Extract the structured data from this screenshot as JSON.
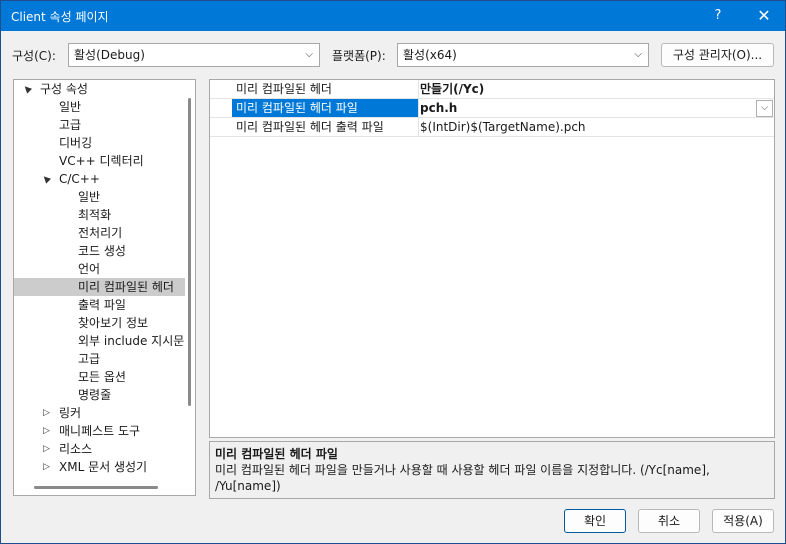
{
  "window": {
    "title": "Client 속성 페이지",
    "help_glyph": "?",
    "close_glyph": "✕"
  },
  "toolbar": {
    "config_label": "구성(C):",
    "config_value": "활성(Debug)",
    "platform_label": "플랫폼(P):",
    "platform_value": "활성(x64)",
    "config_manager_label": "구성 관리자(O)..."
  },
  "tree": {
    "items": [
      {
        "label": "구성 속성",
        "expander": "expanded",
        "level": 0
      },
      {
        "label": "일반",
        "expander": "none",
        "level": 1
      },
      {
        "label": "고급",
        "expander": "none",
        "level": 1
      },
      {
        "label": "디버깅",
        "expander": "none",
        "level": 1
      },
      {
        "label": "VC++ 디렉터리",
        "expander": "none",
        "level": 1
      },
      {
        "label": "C/C++",
        "expander": "expanded",
        "level": 1
      },
      {
        "label": "일반",
        "expander": "none",
        "level": 2
      },
      {
        "label": "최적화",
        "expander": "none",
        "level": 2
      },
      {
        "label": "전처리기",
        "expander": "none",
        "level": 2
      },
      {
        "label": "코드 생성",
        "expander": "none",
        "level": 2
      },
      {
        "label": "언어",
        "expander": "none",
        "level": 2
      },
      {
        "label": "미리 컴파일된 헤더",
        "expander": "none",
        "level": 2,
        "selected": true
      },
      {
        "label": "출력 파일",
        "expander": "none",
        "level": 2
      },
      {
        "label": "찾아보기 정보",
        "expander": "none",
        "level": 2
      },
      {
        "label": "외부 include 지시문",
        "expander": "none",
        "level": 2
      },
      {
        "label": "고급",
        "expander": "none",
        "level": 2
      },
      {
        "label": "모든 옵션",
        "expander": "none",
        "level": 2
      },
      {
        "label": "명령줄",
        "expander": "none",
        "level": 2
      },
      {
        "label": "링커",
        "expander": "collapsed",
        "level": 1
      },
      {
        "label": "매니페스트 도구",
        "expander": "collapsed",
        "level": 1
      },
      {
        "label": "리소스",
        "expander": "collapsed",
        "level": 1
      },
      {
        "label": "XML 문서 생성기",
        "expander": "collapsed",
        "level": 1
      }
    ]
  },
  "grid": {
    "rows": [
      {
        "name": "미리 컴파일된 헤더",
        "value": "만들기(/Yc)",
        "bold": true,
        "selected": false
      },
      {
        "name": "미리 컴파일된 헤더 파일",
        "value": "pch.h",
        "bold": true,
        "selected": true
      },
      {
        "name": "미리 컴파일된 헤더 출력 파일",
        "value": "$(IntDir)$(TargetName).pch",
        "bold": false,
        "selected": false
      }
    ]
  },
  "description": {
    "title": "미리 컴파일된 헤더 파일",
    "text": "미리 컴파일된 헤더 파일을 만들거나 사용할 때 사용할 헤더 파일 이름을 지정합니다. (/Yc[name], /Yu[name])"
  },
  "buttons": {
    "ok": "확인",
    "cancel": "취소",
    "apply": "적용(A)"
  },
  "icons": {
    "expanded": "▲",
    "collapsed": "▷",
    "dropdown": "⌵"
  },
  "colors": {
    "accent": "#0078d7",
    "tree_selection": "#cccccc",
    "dialog_bg": "#f0f0f0"
  }
}
